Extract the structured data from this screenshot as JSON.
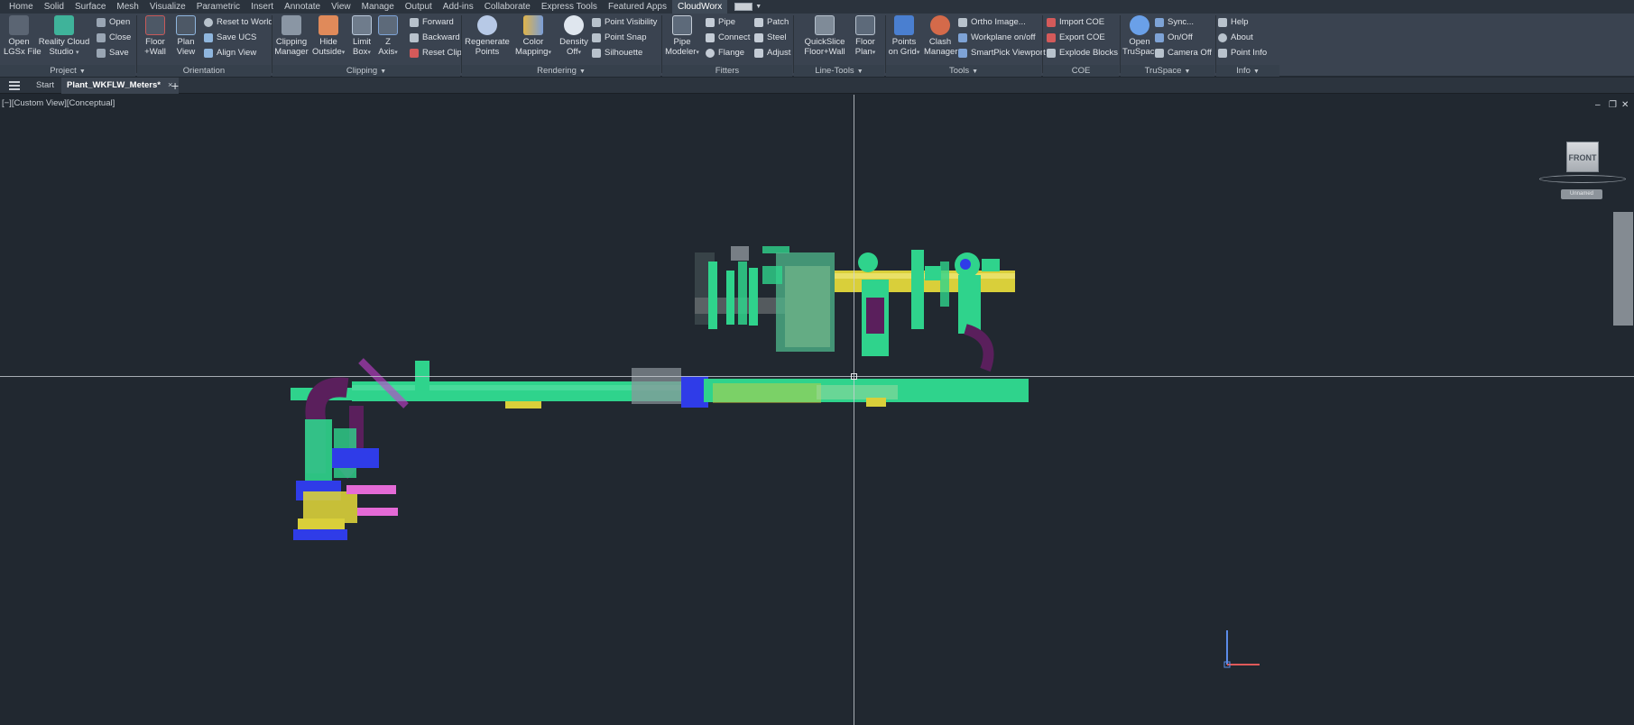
{
  "menu": {
    "items": [
      "Home",
      "Solid",
      "Surface",
      "Mesh",
      "Visualize",
      "Parametric",
      "Insert",
      "Annotate",
      "View",
      "Manage",
      "Output",
      "Add-ins",
      "Collaborate",
      "Express Tools",
      "Featured Apps",
      "CloudWorx"
    ],
    "active": "CloudWorx"
  },
  "ribbon": {
    "project": {
      "label": "Project",
      "open_lgsx": [
        "Open",
        "LGSx File"
      ],
      "reality_cloud": [
        "Reality Cloud",
        "Studio"
      ],
      "open": "Open",
      "close": "Close",
      "save": "Save"
    },
    "orientation": {
      "label": "Orientation",
      "floor_wall": [
        "Floor",
        "Wall"
      ],
      "plan_view": [
        "Plan",
        "View"
      ],
      "reset_world": "Reset to World",
      "save_ucs": "Save UCS",
      "align_view": "Align View"
    },
    "clipping": {
      "label": "Clipping",
      "clipping_manager": [
        "Clipping",
        "Manager"
      ],
      "hide_outside": [
        "Hide",
        "Outside"
      ],
      "limit_box": [
        "Limit",
        "Box"
      ],
      "z_axis": [
        "Z",
        "Axis"
      ],
      "forward": "Forward",
      "backward": "Backward",
      "reset_clip": "Reset Clip"
    },
    "rendering": {
      "label": "Rendering",
      "regenerate": [
        "Regenerate",
        "Points"
      ],
      "color_mapping": [
        "Color",
        "Mapping"
      ],
      "density_off": [
        "Density",
        "Off"
      ],
      "point_visibility": "Point Visibility",
      "point_snap": "Point Snap",
      "silhouette": "Silhouette"
    },
    "fitters": {
      "label": "Fitters",
      "pipe_modeler": [
        "Pipe",
        "Modeler"
      ],
      "pipe": "Pipe",
      "connect": "Connect",
      "flange": "Flange",
      "patch": "Patch",
      "steel": "Steel",
      "adjust": "Adjust"
    },
    "line_tools": {
      "label": "Line-Tools",
      "quickslice": [
        "QuickSlice",
        "Floor+Wall"
      ],
      "floor_plan": [
        "Floor",
        "Plan"
      ]
    },
    "tools": {
      "label": "Tools",
      "points_on_grid": [
        "Points",
        "on Grid"
      ],
      "clash_manager": [
        "Clash",
        "Manager"
      ],
      "ortho_image": "Ortho Image...",
      "workplane": "Workplane on/off",
      "smartpick": "SmartPick Viewport"
    },
    "coe": {
      "label": "COE",
      "import": "Import COE",
      "export": "Export COE",
      "explode": "Explode Blocks"
    },
    "truspace": {
      "label": "TruSpace",
      "open": [
        "Open",
        "TruSpace"
      ],
      "sync": "Sync...",
      "onoff": "On/Off",
      "camera_off": "Camera Off"
    },
    "info": {
      "label": "Info",
      "help": "Help",
      "about": "About",
      "point_info": "Point Info"
    }
  },
  "tabs": {
    "start": "Start",
    "active": "Plant_WKFLW_Meters*",
    "close": "×",
    "add": "+"
  },
  "viewport": {
    "label": "[−][Custom View][Conceptual]",
    "controls": [
      "–",
      "❐",
      "✕"
    ],
    "viewcube_face": "FRONT",
    "unnamed_label": "Unnamed"
  },
  "colors": {
    "ribbon_bg": "#3a4350",
    "viewport_bg": "#212830",
    "cloud_green": "#2fd38c",
    "cloud_yellow": "#d9cf3a",
    "cloud_blue": "#2f3ce8",
    "cloud_magenta": "#c63fd0",
    "cloud_purple": "#5a1f5c"
  }
}
